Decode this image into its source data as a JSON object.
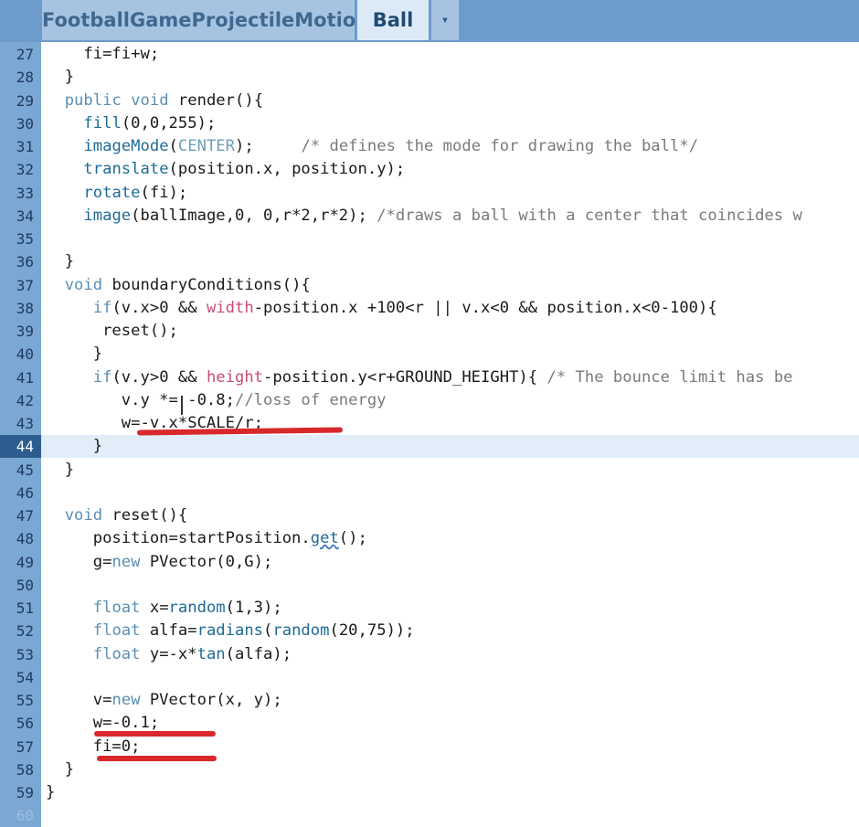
{
  "tabs": [
    {
      "label": "FootballGameProjectileMotion",
      "active": false
    },
    {
      "label": "Ball",
      "active": true
    }
  ],
  "tab_menu_glyph": "▾",
  "current_line": 44,
  "lines": [
    {
      "n": "27",
      "tokens": [
        {
          "t": "    fi=fi+w;"
        }
      ]
    },
    {
      "n": "28",
      "tokens": [
        {
          "t": "  }"
        }
      ]
    },
    {
      "n": "29",
      "tokens": [
        {
          "t": "  "
        },
        {
          "t": "public",
          "k": "kw"
        },
        {
          "t": " "
        },
        {
          "t": "void",
          "k": "kw"
        },
        {
          "t": " render(){"
        }
      ]
    },
    {
      "n": "30",
      "tokens": [
        {
          "t": "    "
        },
        {
          "t": "fill",
          "k": "fn"
        },
        {
          "t": "(0,0,255);"
        }
      ]
    },
    {
      "n": "31",
      "tokens": [
        {
          "t": "    "
        },
        {
          "t": "imageMode",
          "k": "fn"
        },
        {
          "t": "("
        },
        {
          "t": "CENTER",
          "k": "cst"
        },
        {
          "t": ");     "
        },
        {
          "t": "/* defines the mode for drawing the ball*/",
          "k": "cm"
        }
      ]
    },
    {
      "n": "32",
      "tokens": [
        {
          "t": "    "
        },
        {
          "t": "translate",
          "k": "fn"
        },
        {
          "t": "(position.x, position.y);"
        }
      ]
    },
    {
      "n": "33",
      "tokens": [
        {
          "t": "    "
        },
        {
          "t": "rotate",
          "k": "fn"
        },
        {
          "t": "(fi);"
        }
      ]
    },
    {
      "n": "34",
      "tokens": [
        {
          "t": "    "
        },
        {
          "t": "image",
          "k": "fn"
        },
        {
          "t": "(ballImage,0, 0,r*2,r*2); "
        },
        {
          "t": "/*draws a ball with a center that coincides w",
          "k": "cm"
        }
      ]
    },
    {
      "n": "35",
      "tokens": []
    },
    {
      "n": "36",
      "tokens": [
        {
          "t": "  }"
        }
      ]
    },
    {
      "n": "37",
      "tokens": [
        {
          "t": "  "
        },
        {
          "t": "void",
          "k": "kw"
        },
        {
          "t": " boundaryConditions(){"
        }
      ]
    },
    {
      "n": "38",
      "tokens": [
        {
          "t": "     "
        },
        {
          "t": "if",
          "k": "kw"
        },
        {
          "t": "(v.x>0 && "
        },
        {
          "t": "width",
          "k": "var"
        },
        {
          "t": "-position.x +100<r || v.x<0 && position.x<0-100){"
        }
      ]
    },
    {
      "n": "39",
      "tokens": [
        {
          "t": "      reset();"
        }
      ]
    },
    {
      "n": "40",
      "tokens": [
        {
          "t": "     }"
        }
      ]
    },
    {
      "n": "41",
      "tokens": [
        {
          "t": "     "
        },
        {
          "t": "if",
          "k": "kw"
        },
        {
          "t": "(v.y>0 && "
        },
        {
          "t": "height",
          "k": "var"
        },
        {
          "t": "-position.y<r+GROUND_HEIGHT){ "
        },
        {
          "t": "/* The bounce limit has be",
          "k": "cm"
        }
      ]
    },
    {
      "n": "42",
      "tokens": [
        {
          "t": "        v.y *= -0.8;"
        },
        {
          "t": "//loss of energy",
          "k": "cm"
        }
      ]
    },
    {
      "n": "43",
      "tokens": [
        {
          "t": "        w=-v.x*SCALE/r;"
        }
      ]
    },
    {
      "n": "44",
      "tokens": [
        {
          "t": "     }"
        }
      ]
    },
    {
      "n": "45",
      "tokens": [
        {
          "t": "  }"
        }
      ]
    },
    {
      "n": "46",
      "tokens": []
    },
    {
      "n": "47",
      "tokens": [
        {
          "t": "  "
        },
        {
          "t": "void",
          "k": "kw"
        },
        {
          "t": " reset(){"
        }
      ]
    },
    {
      "n": "48",
      "tokens": [
        {
          "t": "     position=startPosition."
        },
        {
          "t": "get",
          "k": "fn sq"
        },
        {
          "t": "();"
        }
      ]
    },
    {
      "n": "49",
      "tokens": [
        {
          "t": "     g="
        },
        {
          "t": "new",
          "k": "kw"
        },
        {
          "t": " PVector(0,G);"
        }
      ]
    },
    {
      "n": "50",
      "tokens": []
    },
    {
      "n": "51",
      "tokens": [
        {
          "t": "     "
        },
        {
          "t": "float",
          "k": "kw"
        },
        {
          "t": " x="
        },
        {
          "t": "random",
          "k": "fn"
        },
        {
          "t": "(1,3);"
        }
      ]
    },
    {
      "n": "52",
      "tokens": [
        {
          "t": "     "
        },
        {
          "t": "float",
          "k": "kw"
        },
        {
          "t": " alfa="
        },
        {
          "t": "radians",
          "k": "fn"
        },
        {
          "t": "("
        },
        {
          "t": "random",
          "k": "fn"
        },
        {
          "t": "(20,75));"
        }
      ]
    },
    {
      "n": "53",
      "tokens": [
        {
          "t": "     "
        },
        {
          "t": "float",
          "k": "kw"
        },
        {
          "t": " y=-x*"
        },
        {
          "t": "tan",
          "k": "fn"
        },
        {
          "t": "(alfa);"
        }
      ]
    },
    {
      "n": "54",
      "tokens": []
    },
    {
      "n": "55",
      "tokens": [
        {
          "t": "     v="
        },
        {
          "t": "new",
          "k": "kw"
        },
        {
          "t": " PVector(x, y);"
        }
      ]
    },
    {
      "n": "56",
      "tokens": [
        {
          "t": "     w=-0.1;"
        }
      ]
    },
    {
      "n": "57",
      "tokens": [
        {
          "t": "     fi=0;"
        }
      ]
    },
    {
      "n": "58",
      "tokens": [
        {
          "t": "  }"
        }
      ]
    },
    {
      "n": "59",
      "tokens": [
        {
          "t": "}"
        }
      ]
    },
    {
      "n": "60",
      "tokens": [],
      "faded": true
    }
  ]
}
